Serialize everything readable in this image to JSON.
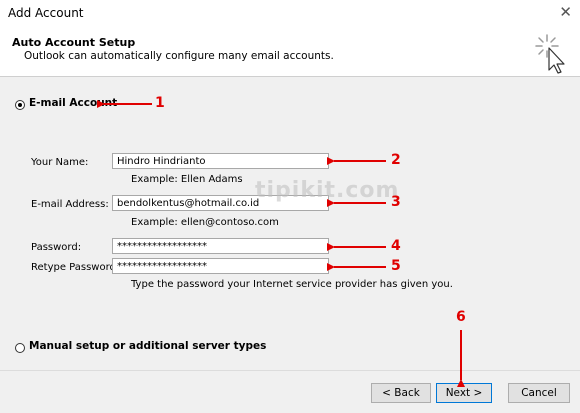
{
  "window": {
    "title": "Add Account",
    "close_glyph": "✕"
  },
  "header": {
    "title": "Auto Account Setup",
    "subtitle": "Outlook can automatically configure many email accounts.",
    "icon": "wizard-cursor-icon"
  },
  "email_option": {
    "label": "E-mail Account",
    "selected": true
  },
  "form": {
    "name_label": "Your Name:",
    "name_value": "Hindro Hindrianto",
    "name_example": "Example: Ellen Adams",
    "email_label": "E-mail Address:",
    "email_value": "bendolkentus@hotmail.co.id",
    "email_example": "Example: ellen@contoso.com",
    "password_label": "Password:",
    "password_value": "******************",
    "retype_label": "Retype Password:",
    "retype_value": "******************",
    "password_hint": "Type the password your Internet service provider has given you."
  },
  "manual_option": {
    "label": "Manual setup or additional server types",
    "selected": false
  },
  "buttons": {
    "back": "< Back",
    "next": "Next >",
    "cancel": "Cancel"
  },
  "watermark": "tipikit.com",
  "annotations": [
    "1",
    "2",
    "3",
    "4",
    "5",
    "6"
  ],
  "colors": {
    "annotation": "#e00000",
    "panel": "#f0f0f0",
    "primary_border": "#0078d7"
  }
}
